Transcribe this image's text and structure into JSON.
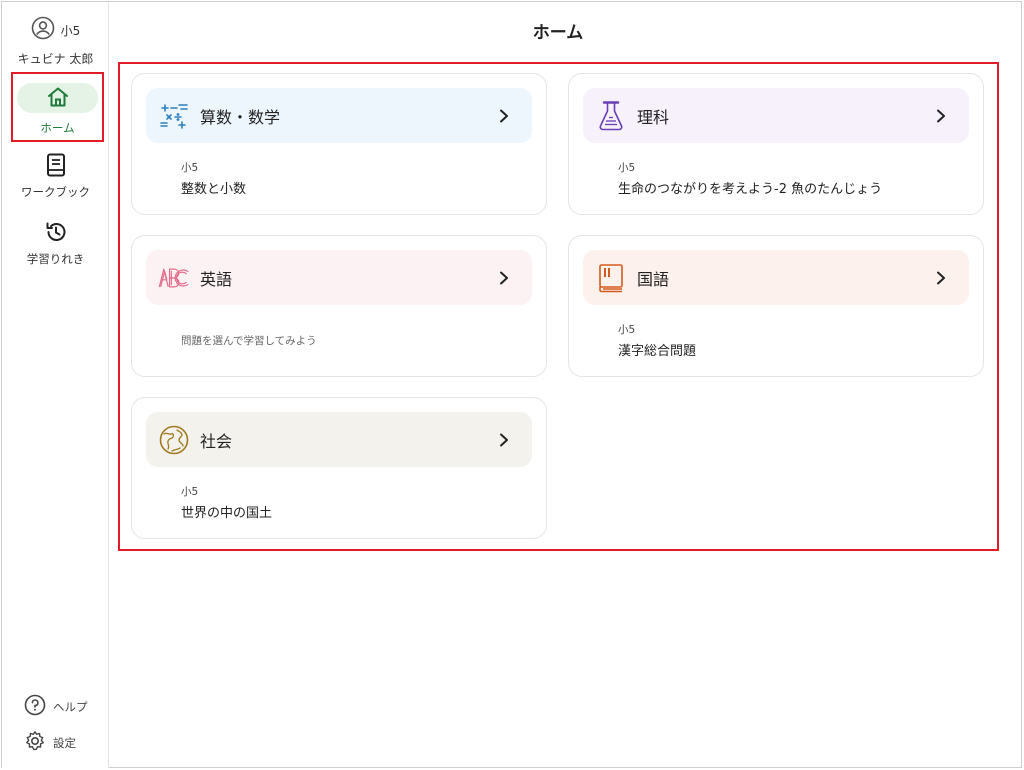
{
  "user": {
    "grade": "小5",
    "name": "キュビナ 太郎"
  },
  "nav": {
    "home": "ホーム",
    "workbook": "ワークブック",
    "history": "学習りれき"
  },
  "footer": {
    "help": "ヘルプ",
    "settings": "設定"
  },
  "page": {
    "title": "ホーム"
  },
  "colors": {
    "accent_green": "#1f7a3b",
    "highlight_red": "#e21b24"
  },
  "subjects": [
    {
      "title": "算数・数学",
      "grade": "小5",
      "unit": "整数と小数",
      "icon": "math-icon",
      "bg": "#eef6fd"
    },
    {
      "title": "理科",
      "grade": "小5",
      "unit": "生命のつながりを考えよう-2 魚のたんじょう",
      "icon": "flask-icon",
      "bg": "#f6f1fb"
    },
    {
      "title": "英語",
      "hint": "問題を選んで学習してみよう",
      "icon": "abc-icon",
      "bg": "#fcf2f4"
    },
    {
      "title": "国語",
      "grade": "小5",
      "unit": "漢字総合問題",
      "icon": "book-icon",
      "bg": "#fcf1ec"
    },
    {
      "title": "社会",
      "grade": "小5",
      "unit": "世界の中の国土",
      "icon": "globe-icon",
      "bg": "#f3f2ec"
    }
  ]
}
